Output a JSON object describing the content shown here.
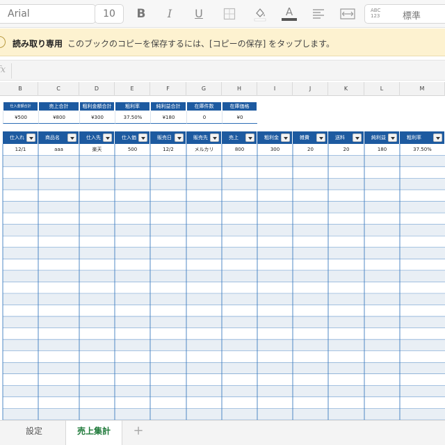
{
  "toolbar": {
    "font_name": "Arial",
    "font_size": "10",
    "bold_label": "B",
    "italic_label": "I",
    "underline_label": "U",
    "text_color_label": "A",
    "number_format_abc": "ABC 123",
    "number_format": "標準",
    "icons": [
      "borders-icon",
      "fill-color-icon",
      "font-color-icon",
      "align-icon",
      "wrap-icon"
    ]
  },
  "banner": {
    "icon": "!",
    "title": "読み取り専用",
    "message": "このブックのコピーを保存するには、[コピーの保存] をタップします。"
  },
  "formula_bar": {
    "label": "fx"
  },
  "columns": [
    "B",
    "C",
    "D",
    "E",
    "F",
    "G",
    "H",
    "I",
    "J",
    "K",
    "L",
    "M"
  ],
  "summary": {
    "headers": [
      "仕入金額合計",
      "売上合計",
      "粗利金額合計",
      "粗利率",
      "純利益合計",
      "在庫件数",
      "在庫価格"
    ],
    "values": [
      "¥500",
      "¥800",
      "¥300",
      "37.50%",
      "¥180",
      "0",
      "¥0"
    ]
  },
  "table": {
    "headers": [
      "仕入れ",
      "商品名",
      "仕入先",
      "仕入価",
      "販売日",
      "販売先",
      "売上",
      "粗利金",
      "雑費",
      "送料",
      "純利益",
      "粗利率"
    ],
    "rows": [
      [
        "12/1",
        "aaa",
        "楽天",
        "500",
        "12/2",
        "メルカリ",
        "800",
        "300",
        "20",
        "20",
        "180",
        "37.50%"
      ]
    ]
  },
  "tabs": {
    "settings": "設定",
    "sales": "売上集計",
    "add": "+"
  },
  "colors": {
    "header_blue": "#1d5aa0",
    "active_tab": "#1f7a3a",
    "banner_bg": "#fdf2d0"
  }
}
